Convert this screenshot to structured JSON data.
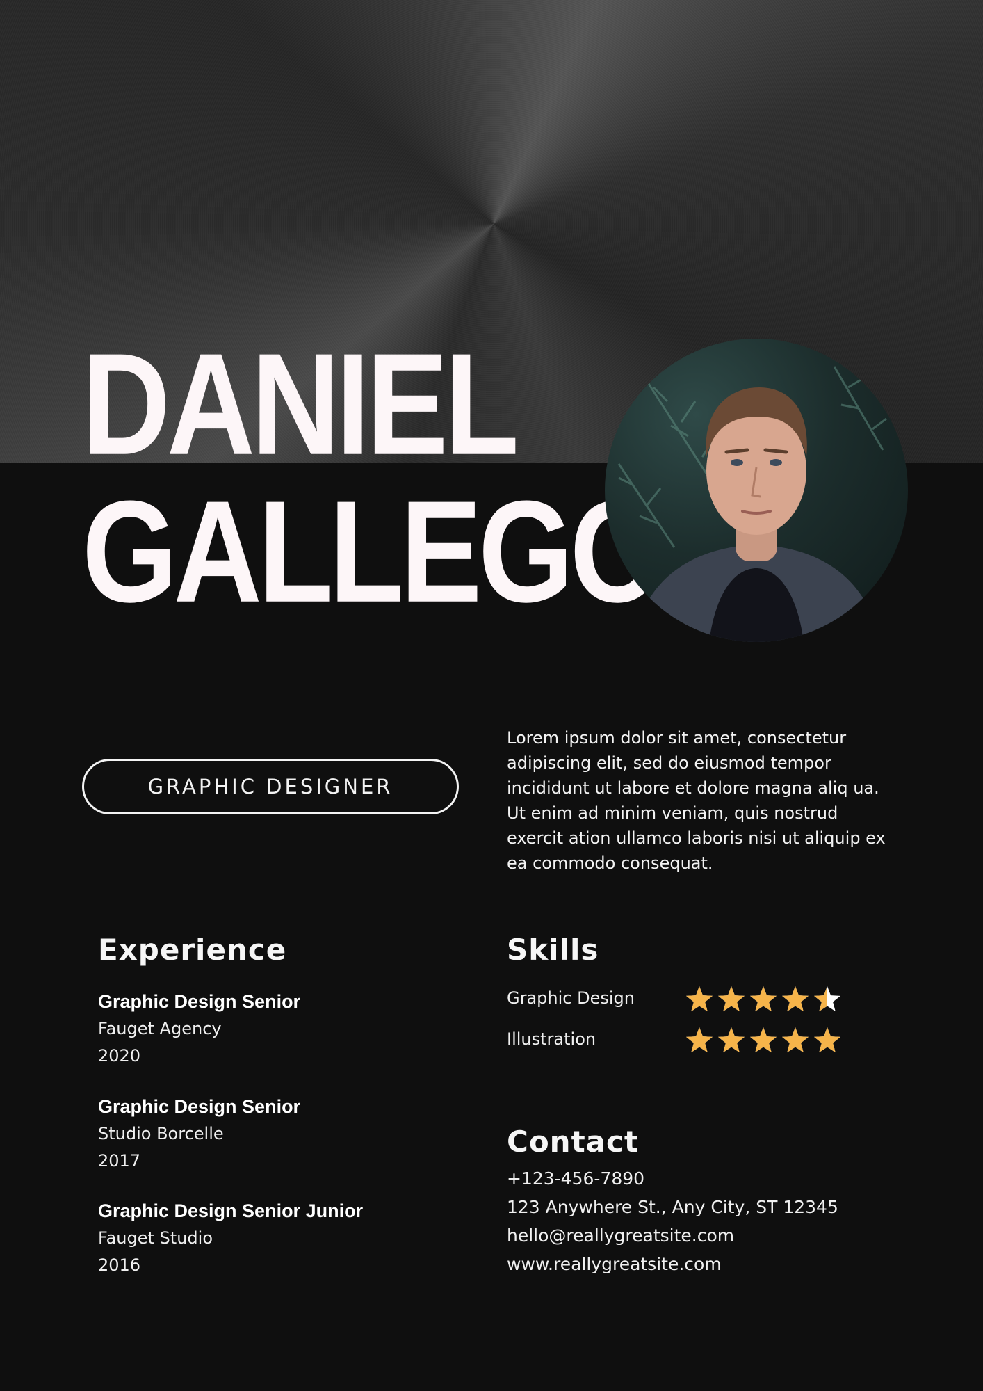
{
  "header": {
    "first_name": "DANIEL",
    "last_name": "GALLEGO",
    "photo_icon": "portrait-photo"
  },
  "role": "GRAPHIC DESIGNER",
  "bio": "Lorem ipsum dolor sit amet, consectetur adipiscing elit, sed do eiusmod tempor incididunt ut labore et dolore magna aliq ua. Ut enim ad minim veniam, quis nostrud exercit ation ullamco laboris nisi ut aliquip ex ea commodo consequat.",
  "experience": {
    "title": "Experience",
    "items": [
      {
        "role": "Graphic Design Senior",
        "company": "Fauget Agency",
        "year": "2020"
      },
      {
        "role": "Graphic Design Senior",
        "company": "Studio Borcelle",
        "year": "2017"
      },
      {
        "role": "Graphic Design Senior Junior",
        "company": "Fauget Studio",
        "year": "2016"
      }
    ]
  },
  "skills": {
    "title": "Skills",
    "star_color": "#f6b44a",
    "items": [
      {
        "label": "Graphic Design",
        "rating": 4.5,
        "max": 5
      },
      {
        "label": "Illustration",
        "rating": 5,
        "max": 5
      }
    ]
  },
  "contact": {
    "title": "Contact",
    "phone": "+123-456-7890",
    "address": "123 Anywhere St., Any City, ST 12345",
    "email": "hello@reallygreatsite.com",
    "website": "www.reallygreatsite.com"
  }
}
